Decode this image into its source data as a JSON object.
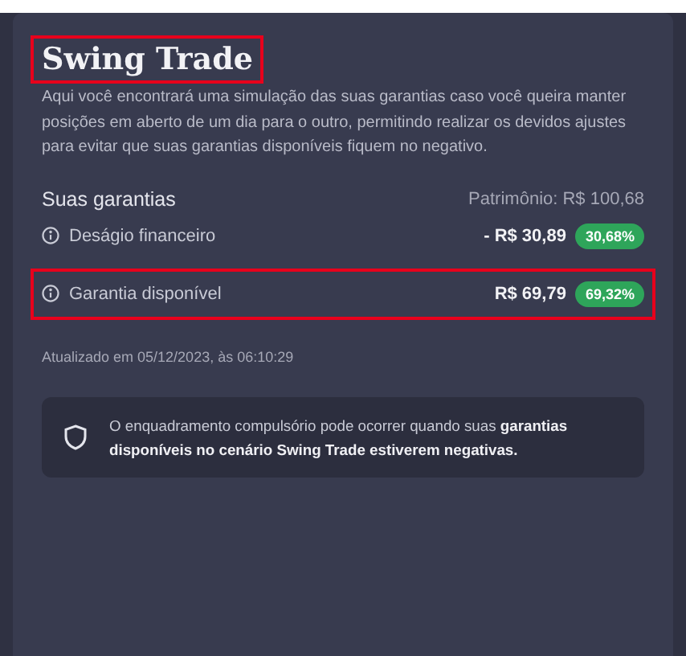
{
  "title": {
    "text": "Swing Trade",
    "highlighted": true
  },
  "description": "Aqui você encontrará uma simulação das suas garantias caso você queira manter posições em aberto de um dia para o outro, permitindo realizar os devidos ajustes para evitar que suas garantias disponíveis fiquem no negativo.",
  "summary": {
    "heading": "Suas garantias",
    "patrimony": "Patrimônio: R$ 100,68"
  },
  "rows": [
    {
      "label": "Deságio financeiro",
      "value": "- R$ 30,89",
      "badge": "30,68%",
      "highlighted": false
    },
    {
      "label": "Garantia disponível",
      "value": "R$ 69,79",
      "badge": "69,32%",
      "highlighted": true
    }
  ],
  "updated": "Atualizado em 05/12/2023, às 06:10:29",
  "notice": "O enquadramento compulsório pode ocorrer quando suas **garantias disponíveis no cenário Swing Trade estiverem negativas.**"
}
